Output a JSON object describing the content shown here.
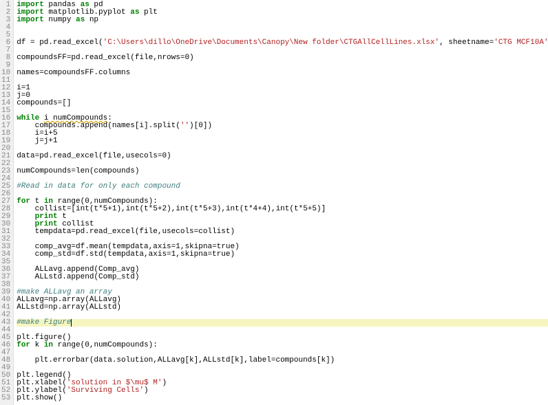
{
  "lines": [
    {
      "n": 1,
      "hl": false,
      "tokens": [
        {
          "t": "import",
          "c": "kw"
        },
        {
          "t": " pandas ",
          "c": ""
        },
        {
          "t": "as",
          "c": "kw"
        },
        {
          "t": " pd",
          "c": ""
        }
      ]
    },
    {
      "n": 2,
      "hl": false,
      "tokens": [
        {
          "t": "import",
          "c": "kw"
        },
        {
          "t": " matplotlib.pyplot ",
          "c": ""
        },
        {
          "t": "as",
          "c": "kw"
        },
        {
          "t": " plt",
          "c": ""
        }
      ]
    },
    {
      "n": 3,
      "hl": false,
      "tokens": [
        {
          "t": "import",
          "c": "kw"
        },
        {
          "t": " numpy ",
          "c": ""
        },
        {
          "t": "as",
          "c": "kw"
        },
        {
          "t": " np",
          "c": ""
        }
      ]
    },
    {
      "n": 4,
      "hl": false,
      "tokens": []
    },
    {
      "n": 5,
      "hl": false,
      "tokens": []
    },
    {
      "n": 6,
      "hl": false,
      "tokens": [
        {
          "t": "df = pd.read_excel(",
          "c": ""
        },
        {
          "t": "'C:\\Users\\dillo\\OneDrive\\Documents\\Canopy\\New folder\\CTGAllCellLines.xlsx'",
          "c": "str"
        },
        {
          "t": ", sheetname=",
          "c": ""
        },
        {
          "t": "'CTG MCF10A'",
          "c": "str"
        },
        {
          "t": ")",
          "c": ""
        }
      ]
    },
    {
      "n": 7,
      "hl": false,
      "tokens": []
    },
    {
      "n": 8,
      "hl": false,
      "tokens": [
        {
          "t": "compoundsFF=pd.read_excel(file,nrows=",
          "c": ""
        },
        {
          "t": "0",
          "c": "num"
        },
        {
          "t": ")",
          "c": ""
        }
      ]
    },
    {
      "n": 9,
      "hl": false,
      "tokens": []
    },
    {
      "n": 10,
      "hl": false,
      "tokens": [
        {
          "t": "names=compoundsFF.columns",
          "c": ""
        }
      ]
    },
    {
      "n": 11,
      "hl": false,
      "tokens": []
    },
    {
      "n": 12,
      "hl": false,
      "tokens": [
        {
          "t": "i=",
          "c": ""
        },
        {
          "t": "1",
          "c": "num"
        }
      ]
    },
    {
      "n": 13,
      "hl": false,
      "tokens": [
        {
          "t": "j=",
          "c": ""
        },
        {
          "t": "0",
          "c": "num"
        }
      ]
    },
    {
      "n": 14,
      "hl": false,
      "tokens": [
        {
          "t": "compounds=[]",
          "c": ""
        }
      ]
    },
    {
      "n": 15,
      "hl": false,
      "tokens": []
    },
    {
      "n": 16,
      "hl": false,
      "tokens": [
        {
          "t": "while",
          "c": "kw"
        },
        {
          "t": " ",
          "c": ""
        },
        {
          "t": "i numCompounds",
          "c": "squiggle"
        },
        {
          "t": ":",
          "c": ""
        }
      ]
    },
    {
      "n": 17,
      "hl": false,
      "tokens": [
        {
          "t": "    compounds.append(names[i].split(",
          "c": ""
        },
        {
          "t": "''",
          "c": "str"
        },
        {
          "t": ")[",
          "c": ""
        },
        {
          "t": "0",
          "c": "num"
        },
        {
          "t": "])",
          "c": ""
        }
      ]
    },
    {
      "n": 18,
      "hl": false,
      "tokens": [
        {
          "t": "    i=i+",
          "c": ""
        },
        {
          "t": "5",
          "c": "num"
        }
      ]
    },
    {
      "n": 19,
      "hl": false,
      "tokens": [
        {
          "t": "    j=j+",
          "c": ""
        },
        {
          "t": "1",
          "c": "num"
        }
      ]
    },
    {
      "n": 20,
      "hl": false,
      "tokens": []
    },
    {
      "n": 21,
      "hl": false,
      "tokens": [
        {
          "t": "data=pd.read_excel(file,usecols=",
          "c": ""
        },
        {
          "t": "0",
          "c": "num"
        },
        {
          "t": ")",
          "c": ""
        }
      ]
    },
    {
      "n": 22,
      "hl": false,
      "tokens": []
    },
    {
      "n": 23,
      "hl": false,
      "tokens": [
        {
          "t": "numCompounds=len(compounds)",
          "c": ""
        }
      ]
    },
    {
      "n": 24,
      "hl": false,
      "tokens": []
    },
    {
      "n": 25,
      "hl": false,
      "tokens": [
        {
          "t": "#Read in data for only each compound",
          "c": "cmt"
        }
      ]
    },
    {
      "n": 26,
      "hl": false,
      "tokens": []
    },
    {
      "n": 27,
      "hl": false,
      "tokens": [
        {
          "t": "for",
          "c": "kw"
        },
        {
          "t": " t ",
          "c": ""
        },
        {
          "t": "in",
          "c": "kw"
        },
        {
          "t": " range(",
          "c": ""
        },
        {
          "t": "0",
          "c": "num"
        },
        {
          "t": ",numCompounds):",
          "c": ""
        }
      ]
    },
    {
      "n": 28,
      "hl": false,
      "tokens": [
        {
          "t": "    collist=[int(t*",
          "c": ""
        },
        {
          "t": "5",
          "c": "num"
        },
        {
          "t": "+",
          "c": ""
        },
        {
          "t": "1",
          "c": "num"
        },
        {
          "t": "),int(t*",
          "c": ""
        },
        {
          "t": "5",
          "c": "num"
        },
        {
          "t": "+",
          "c": ""
        },
        {
          "t": "2",
          "c": "num"
        },
        {
          "t": "),int(t*",
          "c": ""
        },
        {
          "t": "5",
          "c": "num"
        },
        {
          "t": "+",
          "c": ""
        },
        {
          "t": "3",
          "c": "num"
        },
        {
          "t": "),int(t*",
          "c": ""
        },
        {
          "t": "4",
          "c": "num"
        },
        {
          "t": "+",
          "c": ""
        },
        {
          "t": "4",
          "c": "num"
        },
        {
          "t": "),int(t*",
          "c": ""
        },
        {
          "t": "5",
          "c": "num"
        },
        {
          "t": "+",
          "c": ""
        },
        {
          "t": "5",
          "c": "num"
        },
        {
          "t": ")]",
          "c": ""
        }
      ]
    },
    {
      "n": 29,
      "hl": false,
      "tokens": [
        {
          "t": "    ",
          "c": ""
        },
        {
          "t": "print",
          "c": "kw"
        },
        {
          "t": " t",
          "c": ""
        }
      ]
    },
    {
      "n": 30,
      "hl": false,
      "tokens": [
        {
          "t": "    ",
          "c": ""
        },
        {
          "t": "print",
          "c": "kw"
        },
        {
          "t": " collist",
          "c": ""
        }
      ]
    },
    {
      "n": 31,
      "hl": false,
      "tokens": [
        {
          "t": "    tempdata=pd.read_excel(file,usecols=collist)",
          "c": ""
        }
      ]
    },
    {
      "n": 32,
      "hl": false,
      "tokens": []
    },
    {
      "n": 33,
      "hl": false,
      "tokens": [
        {
          "t": "    comp_avg=df.mean(tempdata,axis=",
          "c": ""
        },
        {
          "t": "1",
          "c": "num"
        },
        {
          "t": ",skipna=true)",
          "c": ""
        }
      ]
    },
    {
      "n": 34,
      "hl": false,
      "tokens": [
        {
          "t": "    comp_std=df.std(tempdata,axis=",
          "c": ""
        },
        {
          "t": "1",
          "c": "num"
        },
        {
          "t": ",skipna=true)",
          "c": ""
        }
      ]
    },
    {
      "n": 35,
      "hl": false,
      "tokens": []
    },
    {
      "n": 36,
      "hl": false,
      "tokens": [
        {
          "t": "    ALLavg.append(Comp_avg)",
          "c": ""
        }
      ]
    },
    {
      "n": 37,
      "hl": false,
      "tokens": [
        {
          "t": "    ALLstd.append(Comp_std)",
          "c": ""
        }
      ]
    },
    {
      "n": 38,
      "hl": false,
      "tokens": []
    },
    {
      "n": 39,
      "hl": false,
      "tokens": [
        {
          "t": "#make ALLavg an array",
          "c": "cmt"
        }
      ]
    },
    {
      "n": 40,
      "hl": false,
      "tokens": [
        {
          "t": "ALLavg=np.array(ALLavg)",
          "c": ""
        }
      ]
    },
    {
      "n": 41,
      "hl": false,
      "tokens": [
        {
          "t": "ALLstd=np.array(ALLstd)",
          "c": ""
        }
      ]
    },
    {
      "n": 42,
      "hl": false,
      "tokens": []
    },
    {
      "n": 43,
      "hl": true,
      "tokens": [
        {
          "t": "#make Figure",
          "c": "cmt"
        }
      ],
      "cursor": true
    },
    {
      "n": 44,
      "hl": false,
      "tokens": []
    },
    {
      "n": 45,
      "hl": false,
      "tokens": [
        {
          "t": "plt.figure()",
          "c": ""
        }
      ]
    },
    {
      "n": 46,
      "hl": false,
      "tokens": [
        {
          "t": "for",
          "c": "kw"
        },
        {
          "t": " k ",
          "c": ""
        },
        {
          "t": "in",
          "c": "kw"
        },
        {
          "t": " range(",
          "c": ""
        },
        {
          "t": "0",
          "c": "num"
        },
        {
          "t": ",numCompounds):",
          "c": ""
        }
      ]
    },
    {
      "n": 47,
      "hl": false,
      "tokens": []
    },
    {
      "n": 48,
      "hl": false,
      "tokens": [
        {
          "t": "    plt.errorbar(data.solution,ALLavg[k],ALLstd[k],label=compounds[k])",
          "c": ""
        }
      ]
    },
    {
      "n": 49,
      "hl": false,
      "tokens": []
    },
    {
      "n": 50,
      "hl": false,
      "tokens": [
        {
          "t": "plt.legend()",
          "c": ""
        }
      ]
    },
    {
      "n": 51,
      "hl": false,
      "tokens": [
        {
          "t": "plt.xlabel(",
          "c": ""
        },
        {
          "t": "'solution in $\\mu$ M'",
          "c": "str"
        },
        {
          "t": ")",
          "c": ""
        }
      ]
    },
    {
      "n": 52,
      "hl": false,
      "tokens": [
        {
          "t": "plt.ylabel(",
          "c": ""
        },
        {
          "t": "'Surviving Cells'",
          "c": "str"
        },
        {
          "t": ")",
          "c": ""
        }
      ]
    },
    {
      "n": 53,
      "hl": false,
      "tokens": [
        {
          "t": "plt.show()",
          "c": ""
        }
      ]
    }
  ]
}
